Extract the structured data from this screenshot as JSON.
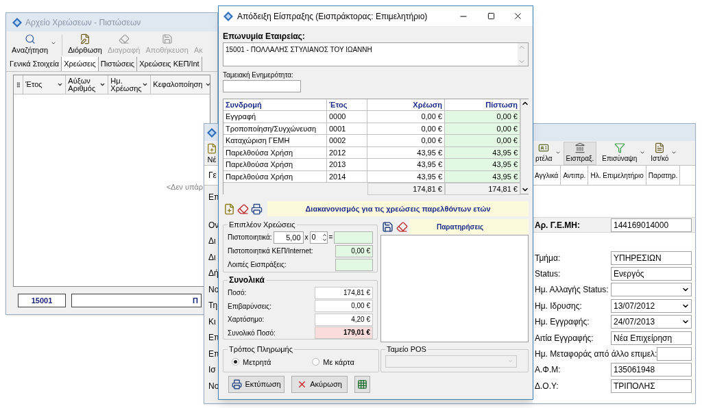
{
  "archive_window": {
    "title": "Αρχείο Χρεώσεων - Πιστώσεων",
    "active": false,
    "toolbar": [
      {
        "label": "Αναζήτηση",
        "kind": "search",
        "disabled": false,
        "has_menu": true
      },
      {
        "label": "Διόρθωση",
        "kind": "edit",
        "disabled": false,
        "has_menu": false
      },
      {
        "label": "Διαγραφή",
        "kind": "erase",
        "disabled": true,
        "has_menu": false
      },
      {
        "label": "Αποθήκευση",
        "kind": "save",
        "disabled": true,
        "has_menu": false
      },
      {
        "label": "Ακ",
        "kind": "other",
        "disabled": true,
        "has_menu": false
      }
    ],
    "tabs": [
      {
        "label": "Γενικά Στοιχεία",
        "selected": false
      },
      {
        "label": "Χρεώσεις",
        "selected": true
      },
      {
        "label": "Πιστώσεις",
        "selected": false
      },
      {
        "label": "Χρεώσεις ΚΕΠ/Int",
        "selected": false
      }
    ],
    "columns": [
      {
        "label": "Έτος"
      },
      {
        "label": "Αύξων Αριθμός"
      },
      {
        "label": "Ημ. Χρέωσης"
      },
      {
        "label": "Κεφαλοποίηση"
      }
    ],
    "empty_text": "<Δεν υπάρ",
    "footer": {
      "code": "15001",
      "name": "Π"
    }
  },
  "company_window": {
    "active": false,
    "toolbar_left": [
      {
        "label": "Νέ",
        "kind": "new"
      }
    ],
    "toolbar": [
      {
        "label": "ρτέλα",
        "kind": "card",
        "selected": false,
        "has_menu": true
      },
      {
        "label": "Εισπραξ.",
        "kind": "cashier",
        "selected": true,
        "has_menu": false
      },
      {
        "label": "Επισύναψη",
        "kind": "funnel",
        "selected": false,
        "has_menu": true
      },
      {
        "label": "Ιστ/κό",
        "kind": "document",
        "selected": false,
        "has_menu": true
      }
    ],
    "tabs_left": [
      {
        "label": "Γε",
        "selected": true
      }
    ],
    "tabs": [
      {
        "label": "Αγγλικά",
        "selected": false
      },
      {
        "label": "Αντιπρ.",
        "selected": false
      },
      {
        "label": "Ηλ. Επιμελητήριο",
        "selected": false
      },
      {
        "label": "Παρατηρ.",
        "selected": false
      }
    ],
    "cut_labels": [
      "Επ",
      "Ον",
      "Δι",
      "Δι",
      "Δή",
      "Νο",
      "Τη",
      "Κι",
      "Επ",
      "Επ",
      "Ισ",
      "Νο"
    ],
    "registry": {
      "label": "Αρ. Γ.Ε.ΜΗ:",
      "value": "144169014000"
    },
    "fields": [
      {
        "label": "Τμήμα:",
        "value": "ΥΠΗΡΕΣΙΩΝ",
        "kind": "text"
      },
      {
        "label": "Status:",
        "value": "Ενεργός",
        "kind": "text"
      },
      {
        "label": "Ημ. Αλλαγής Status:",
        "kind": "dropdown"
      },
      {
        "label": "Ημ. Ιδρυσης:",
        "value": "13/07/2012",
        "kind": "dropdown"
      },
      {
        "label": "Ημ. Εγγραφής:",
        "value": "24/07/2013",
        "kind": "dropdown"
      },
      {
        "label": "Αιτία Εγγραφής:",
        "value": "Νέα Επιχείρηση",
        "kind": "text"
      },
      {
        "label": "Ημ. Μεταφοράς από άλλο επιμελ:",
        "kind": "text"
      },
      {
        "label": "Α.Φ.Μ:",
        "value": "135061948",
        "kind": "text"
      },
      {
        "label": "Δ.Ο.Υ:",
        "value": "ΤΡΙΠΟΛΗΣ",
        "kind": "text"
      }
    ]
  },
  "receipt_dialog": {
    "title": "Απόδειξη Είσπραξης (Εισπράκτορας: Επιμελητήριο)",
    "active": true,
    "company_label": "Επωνυμία Εταιρείας:",
    "company_value": "15001 - ΠΟΛΛΑΛΗΣ ΣΤΥΛΙΑΝΟΣ ΤΟΥ ΙΩΑΝΝΗ",
    "clearance_label": "Ταμειακή Ενημερότητα:",
    "table": {
      "columns": [
        "Συνδρομή",
        "Έτος",
        "Χρέωση",
        "Πίστωση"
      ],
      "rows": [
        [
          "Εγγραφή",
          "0000",
          "0,00 €",
          "0,00 €"
        ],
        [
          "Τροποποίηση/Συγχώνευση",
          "0001",
          "0,00 €",
          "0,00 €"
        ],
        [
          "Καταχώριση ΓΕΜΗ",
          "0002",
          "0,00 €",
          "0,00 €"
        ],
        [
          "Παρελθούσα Χρήση",
          "2012",
          "43,95 €",
          "43,95 €"
        ],
        [
          "Παρελθούσα Χρήση",
          "2013",
          "43,95 €",
          "43,95 €"
        ],
        [
          "Παρελθούσα Χρήση",
          "2014",
          "43,95 €",
          "43,95 €"
        ]
      ],
      "totals": [
        "174,81 €",
        "174,81 €"
      ]
    },
    "installments_bar": "Διακανονισμός για τις χρεώσεις παρελθόντων ετών",
    "extra_charges": {
      "title": "Επιπλέον Χρεώσεις",
      "certificates_label": "Πιστοποιητικά:",
      "unit_price": "5,00",
      "times": "x",
      "quantity": "0",
      "equals": "=",
      "rows": [
        {
          "label": "Πιστοποιητικά ΚΕΠ/Internet:",
          "value": "0,00 €"
        },
        {
          "label": "Λοιπές Εισπράξεις:"
        }
      ]
    },
    "totals": {
      "title": "Συνολικά",
      "rows": [
        {
          "label": "Ποσό:",
          "value": "174,81 €",
          "kind": "plain"
        },
        {
          "label": "Επιβαρύνσεις:",
          "value": "0,00 €",
          "kind": "plain"
        },
        {
          "label": "Χαρτόσημο:",
          "value": "4,20 €",
          "kind": "plain"
        },
        {
          "label": "Συνολικό Ποσό:",
          "value": "179,01 €",
          "kind": "grand"
        }
      ]
    },
    "notes": {
      "title": "Παρατηρήσεις"
    },
    "payment": {
      "title": "Τρόπος Πληρωμής",
      "options": [
        {
          "label": "Μετρητά",
          "selected": true
        },
        {
          "label": "Με κάρτα",
          "selected": false
        }
      ]
    },
    "pos": {
      "title": "Ταμείο POS",
      "disabled": true
    },
    "buttons": [
      {
        "label": "Εκτύπωση",
        "kind": "print"
      },
      {
        "label": "Ακύρωση",
        "kind": "cancel"
      },
      {
        "kind": "calculator"
      }
    ]
  }
}
